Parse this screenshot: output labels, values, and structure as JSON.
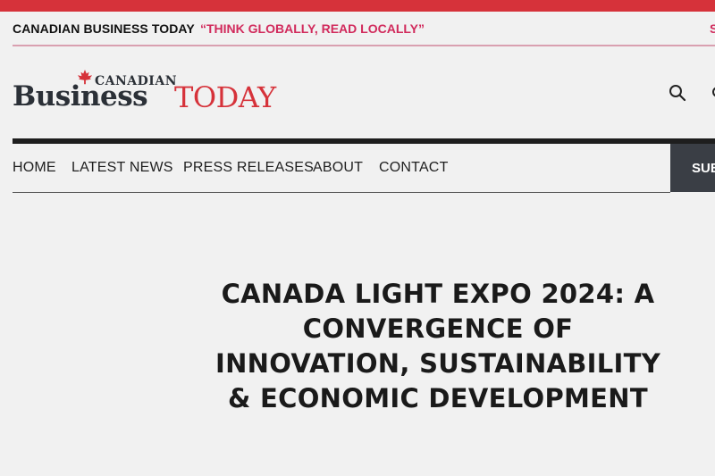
{
  "topbar": {
    "site_name": "CANADIAN BUSINESS TODAY",
    "tagline": "“THINK GLOBALLY, READ LOCALLY”",
    "edge_text": "S"
  },
  "logo": {
    "canadian": "CANADIAN",
    "business": "Business",
    "today": "TODAY"
  },
  "header": {
    "search_icon": "search-icon"
  },
  "nav": {
    "items": [
      {
        "label": "HOME"
      },
      {
        "label": "LATEST NEWS"
      },
      {
        "label": "PRESS RELEASES"
      },
      {
        "label": "ABOUT"
      },
      {
        "label": "CONTACT"
      }
    ],
    "subscribe_label": "SUB"
  },
  "article": {
    "title": "CANADA LIGHT EXPO 2024: A CONVERGENCE OF INNOVATION, SUSTAINABILITY & ECONOMIC DEVELOPMENT"
  },
  "colors": {
    "brand_red": "#d6323a",
    "tagline_pink": "#d12a5c",
    "dark": "#2b3037"
  }
}
